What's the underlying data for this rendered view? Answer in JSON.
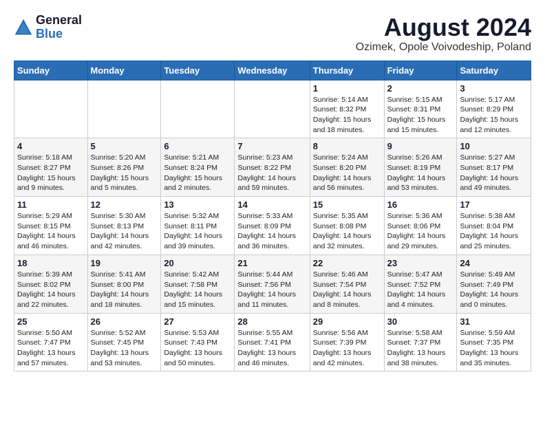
{
  "header": {
    "logo_general": "General",
    "logo_blue": "Blue",
    "title": "August 2024",
    "subtitle": "Ozimek, Opole Voivodeship, Poland"
  },
  "weekdays": [
    "Sunday",
    "Monday",
    "Tuesday",
    "Wednesday",
    "Thursday",
    "Friday",
    "Saturday"
  ],
  "weeks": [
    [
      {
        "day": "",
        "info": ""
      },
      {
        "day": "",
        "info": ""
      },
      {
        "day": "",
        "info": ""
      },
      {
        "day": "",
        "info": ""
      },
      {
        "day": "1",
        "info": "Sunrise: 5:14 AM\nSunset: 8:32 PM\nDaylight: 15 hours\nand 18 minutes."
      },
      {
        "day": "2",
        "info": "Sunrise: 5:15 AM\nSunset: 8:31 PM\nDaylight: 15 hours\nand 15 minutes."
      },
      {
        "day": "3",
        "info": "Sunrise: 5:17 AM\nSunset: 8:29 PM\nDaylight: 15 hours\nand 12 minutes."
      }
    ],
    [
      {
        "day": "4",
        "info": "Sunrise: 5:18 AM\nSunset: 8:27 PM\nDaylight: 15 hours\nand 9 minutes."
      },
      {
        "day": "5",
        "info": "Sunrise: 5:20 AM\nSunset: 8:26 PM\nDaylight: 15 hours\nand 5 minutes."
      },
      {
        "day": "6",
        "info": "Sunrise: 5:21 AM\nSunset: 8:24 PM\nDaylight: 15 hours\nand 2 minutes."
      },
      {
        "day": "7",
        "info": "Sunrise: 5:23 AM\nSunset: 8:22 PM\nDaylight: 14 hours\nand 59 minutes."
      },
      {
        "day": "8",
        "info": "Sunrise: 5:24 AM\nSunset: 8:20 PM\nDaylight: 14 hours\nand 56 minutes."
      },
      {
        "day": "9",
        "info": "Sunrise: 5:26 AM\nSunset: 8:19 PM\nDaylight: 14 hours\nand 53 minutes."
      },
      {
        "day": "10",
        "info": "Sunrise: 5:27 AM\nSunset: 8:17 PM\nDaylight: 14 hours\nand 49 minutes."
      }
    ],
    [
      {
        "day": "11",
        "info": "Sunrise: 5:29 AM\nSunset: 8:15 PM\nDaylight: 14 hours\nand 46 minutes."
      },
      {
        "day": "12",
        "info": "Sunrise: 5:30 AM\nSunset: 8:13 PM\nDaylight: 14 hours\nand 42 minutes."
      },
      {
        "day": "13",
        "info": "Sunrise: 5:32 AM\nSunset: 8:11 PM\nDaylight: 14 hours\nand 39 minutes."
      },
      {
        "day": "14",
        "info": "Sunrise: 5:33 AM\nSunset: 8:09 PM\nDaylight: 14 hours\nand 36 minutes."
      },
      {
        "day": "15",
        "info": "Sunrise: 5:35 AM\nSunset: 8:08 PM\nDaylight: 14 hours\nand 32 minutes."
      },
      {
        "day": "16",
        "info": "Sunrise: 5:36 AM\nSunset: 8:06 PM\nDaylight: 14 hours\nand 29 minutes."
      },
      {
        "day": "17",
        "info": "Sunrise: 5:38 AM\nSunset: 8:04 PM\nDaylight: 14 hours\nand 25 minutes."
      }
    ],
    [
      {
        "day": "18",
        "info": "Sunrise: 5:39 AM\nSunset: 8:02 PM\nDaylight: 14 hours\nand 22 minutes."
      },
      {
        "day": "19",
        "info": "Sunrise: 5:41 AM\nSunset: 8:00 PM\nDaylight: 14 hours\nand 18 minutes."
      },
      {
        "day": "20",
        "info": "Sunrise: 5:42 AM\nSunset: 7:58 PM\nDaylight: 14 hours\nand 15 minutes."
      },
      {
        "day": "21",
        "info": "Sunrise: 5:44 AM\nSunset: 7:56 PM\nDaylight: 14 hours\nand 11 minutes."
      },
      {
        "day": "22",
        "info": "Sunrise: 5:46 AM\nSunset: 7:54 PM\nDaylight: 14 hours\nand 8 minutes."
      },
      {
        "day": "23",
        "info": "Sunrise: 5:47 AM\nSunset: 7:52 PM\nDaylight: 14 hours\nand 4 minutes."
      },
      {
        "day": "24",
        "info": "Sunrise: 5:49 AM\nSunset: 7:49 PM\nDaylight: 14 hours\nand 0 minutes."
      }
    ],
    [
      {
        "day": "25",
        "info": "Sunrise: 5:50 AM\nSunset: 7:47 PM\nDaylight: 13 hours\nand 57 minutes."
      },
      {
        "day": "26",
        "info": "Sunrise: 5:52 AM\nSunset: 7:45 PM\nDaylight: 13 hours\nand 53 minutes."
      },
      {
        "day": "27",
        "info": "Sunrise: 5:53 AM\nSunset: 7:43 PM\nDaylight: 13 hours\nand 50 minutes."
      },
      {
        "day": "28",
        "info": "Sunrise: 5:55 AM\nSunset: 7:41 PM\nDaylight: 13 hours\nand 46 minutes."
      },
      {
        "day": "29",
        "info": "Sunrise: 5:56 AM\nSunset: 7:39 PM\nDaylight: 13 hours\nand 42 minutes."
      },
      {
        "day": "30",
        "info": "Sunrise: 5:58 AM\nSunset: 7:37 PM\nDaylight: 13 hours\nand 38 minutes."
      },
      {
        "day": "31",
        "info": "Sunrise: 5:59 AM\nSunset: 7:35 PM\nDaylight: 13 hours\nand 35 minutes."
      }
    ]
  ]
}
